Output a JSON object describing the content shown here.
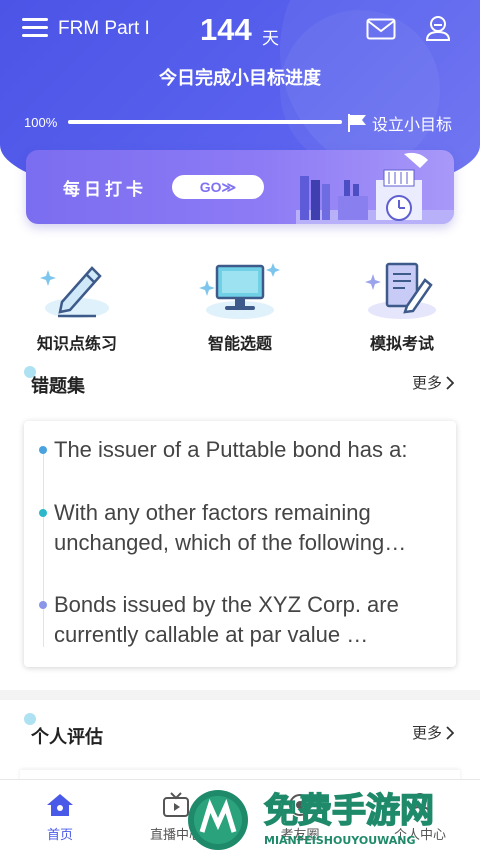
{
  "header": {
    "app_title": "FRM Part I",
    "countdown_days": "144",
    "countdown_unit": "天",
    "goal_heading": "今日完成小目标进度",
    "progress_text": "100%",
    "progress_fraction": 1.0,
    "set_goal_label": "设立小目标",
    "icons": [
      "menu-icon",
      "mail-icon",
      "user-icon",
      "flag-icon"
    ]
  },
  "banner": {
    "title": "每日打卡",
    "go_label": "GO≫"
  },
  "features": [
    {
      "label": "知识点练习",
      "icon": "pen-icon"
    },
    {
      "label": "智能选题",
      "icon": "monitor-icon"
    },
    {
      "label": "模拟考试",
      "icon": "exam-paper-icon"
    }
  ],
  "wrong_questions": {
    "title": "错题集",
    "more_label": "更多",
    "items": [
      {
        "text": "The issuer of a Puttable bond has a:",
        "bullet_color": "#4aa3df"
      },
      {
        "text": "With any other factors remaining unchanged, which of the following…",
        "bullet_color": "#2cb8c8"
      },
      {
        "text": "Bonds issued by the XYZ Corp. are currently callable at par value …",
        "bullet_color": "#8a96e8"
      }
    ]
  },
  "assessment": {
    "title": "个人评估",
    "more_label": "更多"
  },
  "bottom_nav": [
    {
      "label": "首页",
      "icon": "home-icon",
      "active": true
    },
    {
      "label": "直播中心",
      "icon": "tv-icon",
      "active": false
    },
    {
      "label": "考友圈",
      "icon": "circle-icon",
      "active": false
    },
    {
      "label": "个人中心",
      "icon": "person-icon",
      "active": false
    }
  ],
  "watermark": {
    "title": "免费手游网",
    "subtitle": "MIANFEISHOUYOUWANG"
  },
  "colors": {
    "header_bg": "#4b54e6",
    "accent": "#4a5ae8",
    "banner_bg": "#8d7bf5"
  }
}
